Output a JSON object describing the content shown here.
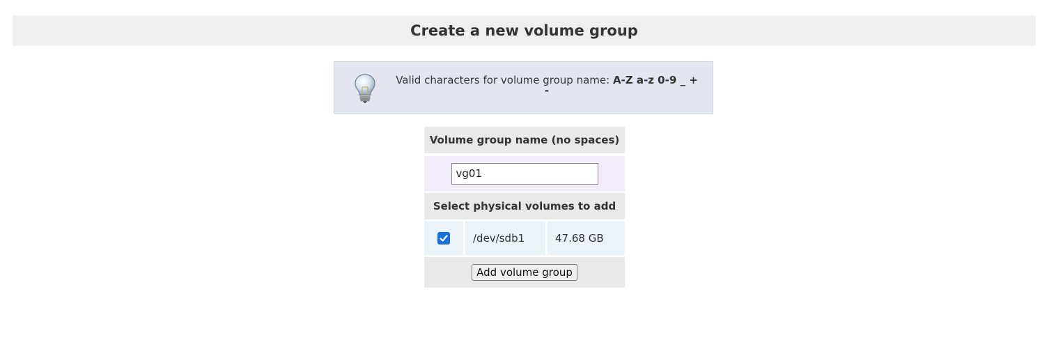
{
  "page": {
    "title": "Create a new volume group"
  },
  "tip": {
    "icon": "lightbulb-icon",
    "text_prefix": "Valid characters for volume group name:",
    "chars_line1": "A-Z a-z 0-9 _ +",
    "chars_line2": "-"
  },
  "form": {
    "name_label": "Volume group name (no spaces)",
    "name_value": "vg01",
    "pv_label": "Select physical volumes to add",
    "physical_volumes": [
      {
        "checked": true,
        "device": "/dev/sdb1",
        "size": "47.68 GB"
      }
    ],
    "submit_label": "Add volume group"
  },
  "colors": {
    "checkbox": "#1a6fd6",
    "header_bg": "#efefef",
    "tip_bg": "#e2e6f0"
  }
}
